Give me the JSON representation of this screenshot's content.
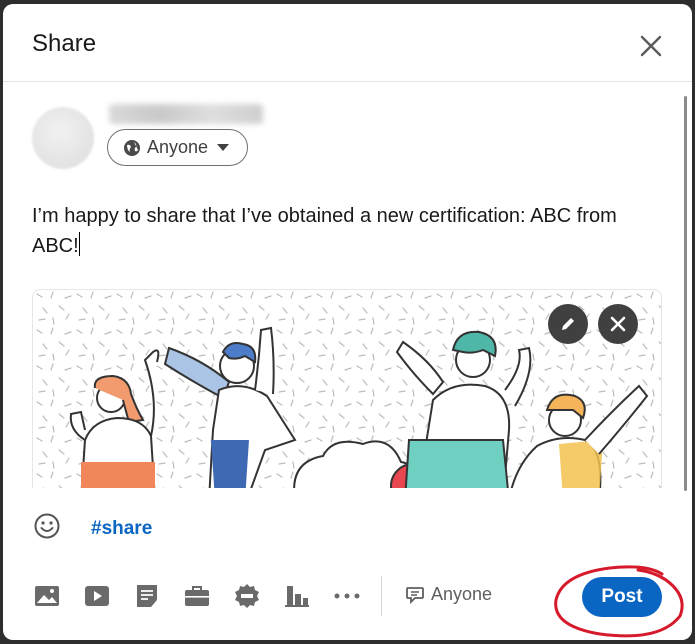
{
  "dialog": {
    "title": "Share"
  },
  "author": {
    "audience_label": "Anyone"
  },
  "post": {
    "text": "I’m happy to share that I’ve obtained a new certification: ABC from ABC!"
  },
  "hashtag": "#share",
  "toolbar": {
    "icons": [
      "photo-icon",
      "video-icon",
      "document-icon",
      "job-icon",
      "celebrate-icon",
      "poll-icon",
      "more-icon"
    ],
    "comment_audience_label": "Anyone",
    "post_label": "Post"
  },
  "colors": {
    "accent": "#0a66c2",
    "annotation": "#d6192b"
  }
}
